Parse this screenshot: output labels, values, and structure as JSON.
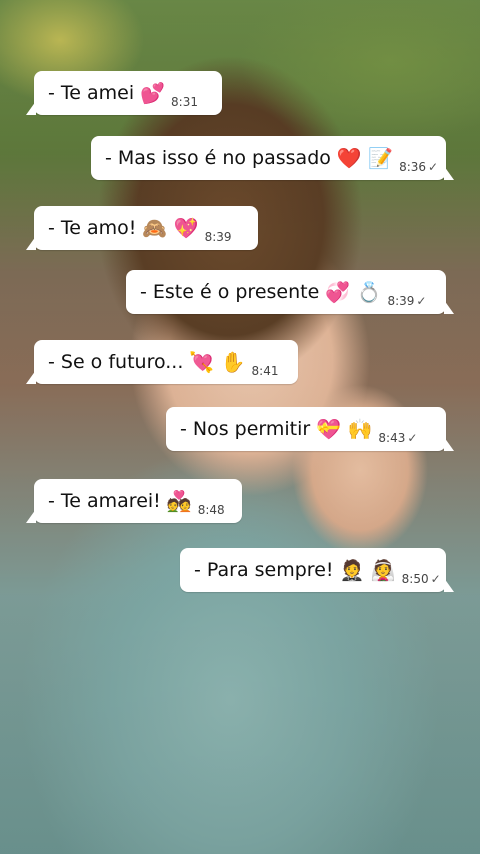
{
  "messages": [
    {
      "text": "- Te amei",
      "emoji": "💕",
      "time": "8:31",
      "dir": "in"
    },
    {
      "text": "- Mas isso é no passado",
      "emoji": "❤️ 📝",
      "time": "8:36",
      "dir": "out",
      "check": "✓"
    },
    {
      "text": "-  Te amo!",
      "emoji": "🙈 💖",
      "time": "8:39",
      "dir": "in"
    },
    {
      "text": "- Este é o presente",
      "emoji": "💞 💍",
      "time": "8:39",
      "dir": "out",
      "check": "✓"
    },
    {
      "text": "-  Se o futuro...",
      "emoji": "💘 ✋",
      "time": "8:41",
      "dir": "in"
    },
    {
      "text": "-  Nos permitir",
      "emoji": "💝 🙌",
      "time": "8:43",
      "dir": "out",
      "check": "✓"
    },
    {
      "text": "- Te amarei!",
      "emoji": "💑",
      "time": "8:48",
      "dir": "in"
    },
    {
      "text": "- Para sempre!",
      "emoji": "🤵 👰",
      "time": "8:50",
      "dir": "out",
      "check": "✓"
    }
  ]
}
